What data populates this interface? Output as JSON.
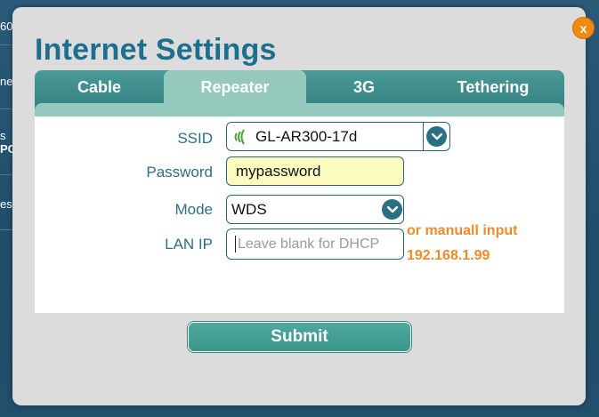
{
  "background_fragments": [
    "60-",
    "ne",
    "s",
    "PC",
    "es"
  ],
  "dialog": {
    "close_label": "x",
    "title": "Internet Settings",
    "tabs": [
      {
        "label": "Cable",
        "active": false
      },
      {
        "label": "Repeater",
        "active": true
      },
      {
        "label": "3G",
        "active": false
      },
      {
        "label": "Tethering",
        "active": false
      }
    ],
    "form": {
      "ssid_label": "SSID",
      "ssid_value": "GL-AR300-17d",
      "password_label": "Password",
      "password_value": "mypassword",
      "mode_label": "Mode",
      "mode_value": "WDS",
      "lan_ip_label": "LAN IP",
      "lan_ip_placeholder": "Leave blank for DHCP",
      "note_line1": "or manuall input",
      "note_line2": "192.168.1.99"
    },
    "submit_label": "Submit"
  },
  "colors": {
    "title": "#1c6f8e",
    "tab_bar": "#2f7c7c",
    "tab_active": "#96c9bd",
    "close_button": "#f08a12",
    "note": "#f08a2c",
    "submit": "#3b958b",
    "password_bg": "#fbfbc0"
  },
  "icons": {
    "close": "close-icon",
    "ssid_signal": "wifi-signal-icon",
    "ssid_dropdown": "chevron-down-icon",
    "mode_dropdown": "chevron-down-icon"
  }
}
